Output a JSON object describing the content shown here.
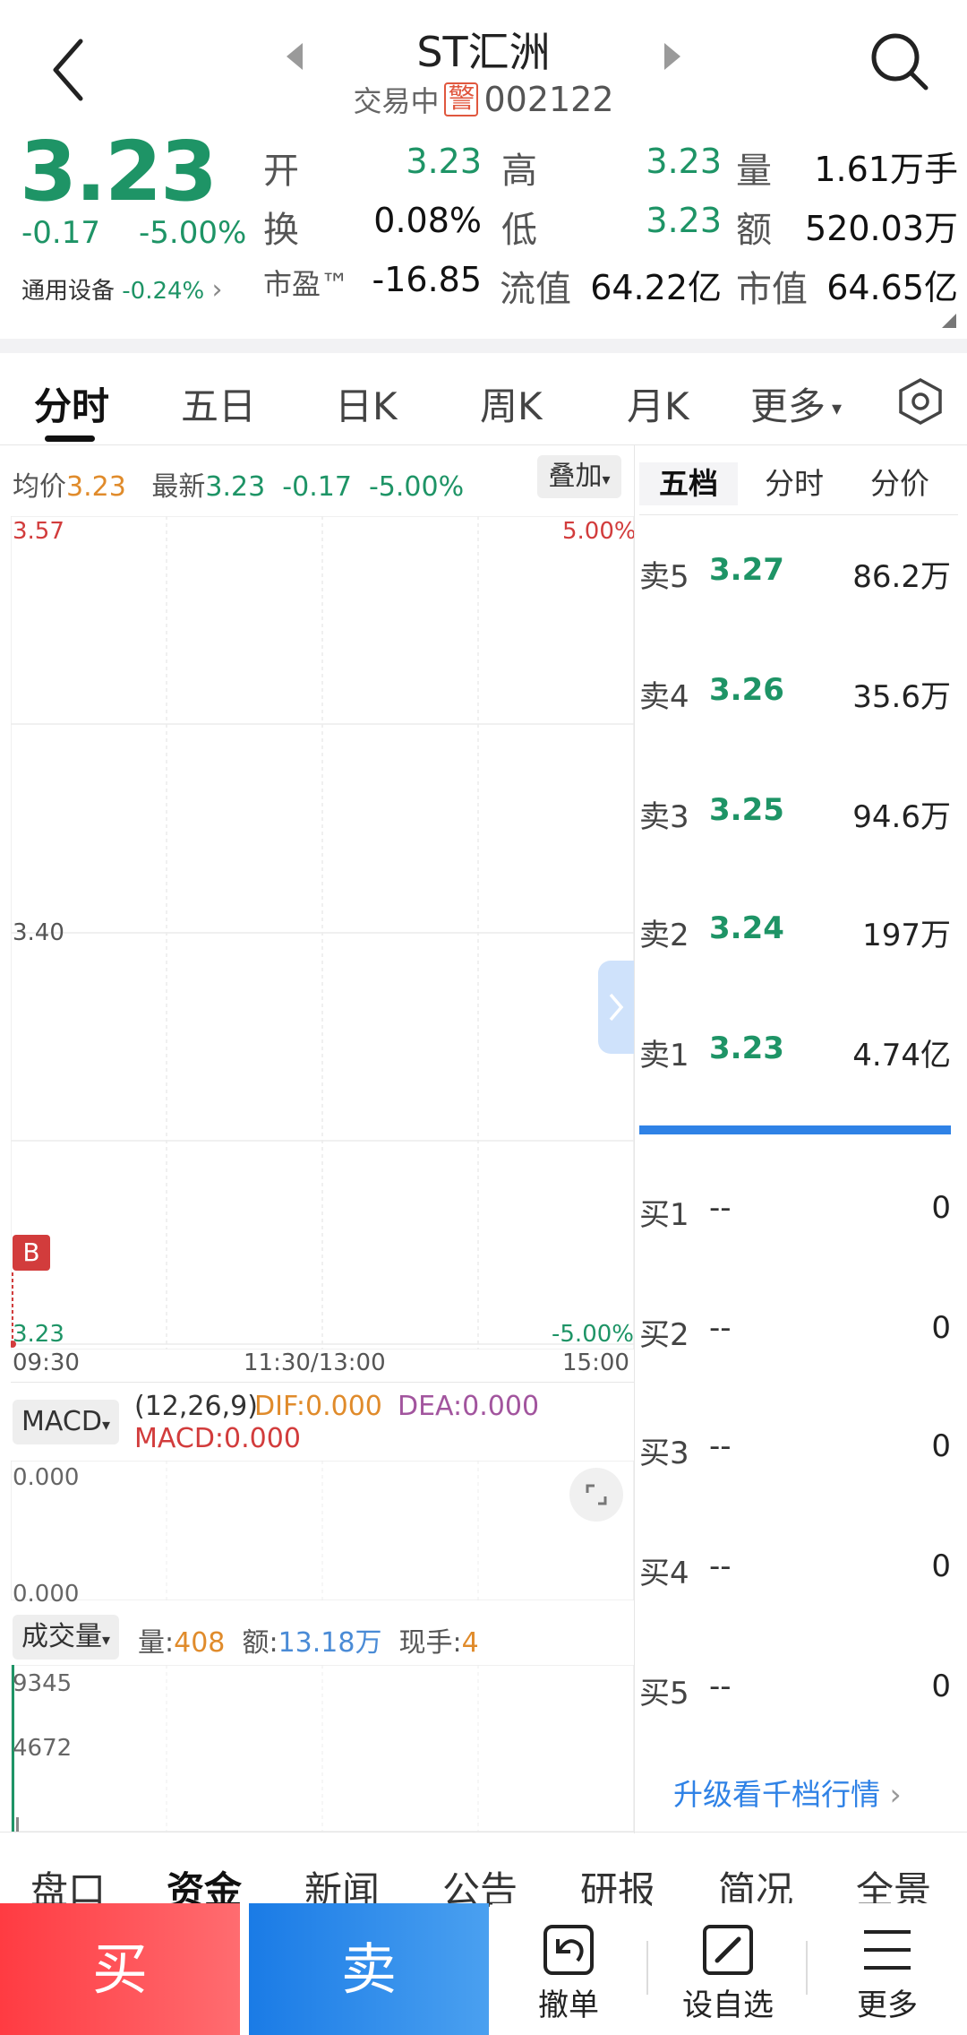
{
  "header": {
    "title": "ST汇洲",
    "status": "交易中",
    "warn_badge": "警",
    "code": "002122"
  },
  "quote": {
    "price": "3.23",
    "change": "-0.17",
    "change_pct": "-5.00%",
    "sector_name": "通用设备",
    "sector_change": "-0.24%",
    "open_label": "开",
    "open": "3.23",
    "high_label": "高",
    "high": "3.23",
    "volume_label": "量",
    "volume": "1.61万手",
    "turnover_label": "换",
    "turnover": "0.08%",
    "low_label": "低",
    "low": "3.23",
    "amount_label": "额",
    "amount": "520.03万",
    "pe_label": "市盈™",
    "pe": "-16.85",
    "float_cap_label": "流值",
    "float_cap": "64.22亿",
    "mkt_cap_label": "市值",
    "mkt_cap": "64.65亿"
  },
  "tabs": [
    "分时",
    "五日",
    "日K",
    "周K",
    "月K",
    "更多"
  ],
  "chart_header": {
    "avg_label": "均价",
    "avg": "3.23",
    "latest_label": "最新",
    "latest": "3.23",
    "latest_change": "-0.17",
    "latest_pct": "-5.00%",
    "overlay_label": "叠加"
  },
  "chart_data": {
    "type": "line",
    "ylim": [
      3.23,
      3.57
    ],
    "y_ticks": [
      "3.57",
      "3.40",
      "3.23"
    ],
    "right_ticks": [
      "5.00%",
      "-5.00%"
    ],
    "x_ticks": [
      "09:30",
      "11:30/13:00",
      "15:00"
    ],
    "series": [
      {
        "values": [
          3.23
        ]
      }
    ],
    "marker": "B"
  },
  "macd": {
    "button": "MACD",
    "params": "(12,26,9)",
    "dif": "DIF:0.000",
    "dea": "DEA:0.000",
    "macd": "MACD:0.000",
    "top": "0.000",
    "bottom": "0.000"
  },
  "volume": {
    "button": "成交量",
    "vol_label": "量:",
    "vol": "408",
    "amt_label": "额:",
    "amt": "13.18万",
    "hand_label": "现手:",
    "hand": "4",
    "tick_top": "9345",
    "tick_mid": "4672"
  },
  "orderbook": {
    "tabs": [
      "五档",
      "分时",
      "分价"
    ],
    "sell": [
      {
        "label": "卖5",
        "price": "3.27",
        "vol": "86.2万"
      },
      {
        "label": "卖4",
        "price": "3.26",
        "vol": "35.6万"
      },
      {
        "label": "卖3",
        "price": "3.25",
        "vol": "94.6万"
      },
      {
        "label": "卖2",
        "price": "3.24",
        "vol": "197万"
      },
      {
        "label": "卖1",
        "price": "3.23",
        "vol": "4.74亿"
      }
    ],
    "buy": [
      {
        "label": "买1",
        "price": "--",
        "vol": "0"
      },
      {
        "label": "买2",
        "price": "--",
        "vol": "0"
      },
      {
        "label": "买3",
        "price": "--",
        "vol": "0"
      },
      {
        "label": "买4",
        "price": "--",
        "vol": "0"
      },
      {
        "label": "买5",
        "price": "--",
        "vol": "0"
      }
    ],
    "upgrade": "升级看千档行情"
  },
  "bottom_tabs": [
    "盘口",
    "资金",
    "新闻",
    "公告",
    "研报",
    "简况",
    "全景"
  ],
  "actions": {
    "buy": "买",
    "sell": "卖",
    "cancel": "撤单",
    "watch": "设自选",
    "more": "更多"
  },
  "colors": {
    "down": "#1e9466",
    "up": "#d23c3c",
    "accent": "#2f82e6"
  }
}
